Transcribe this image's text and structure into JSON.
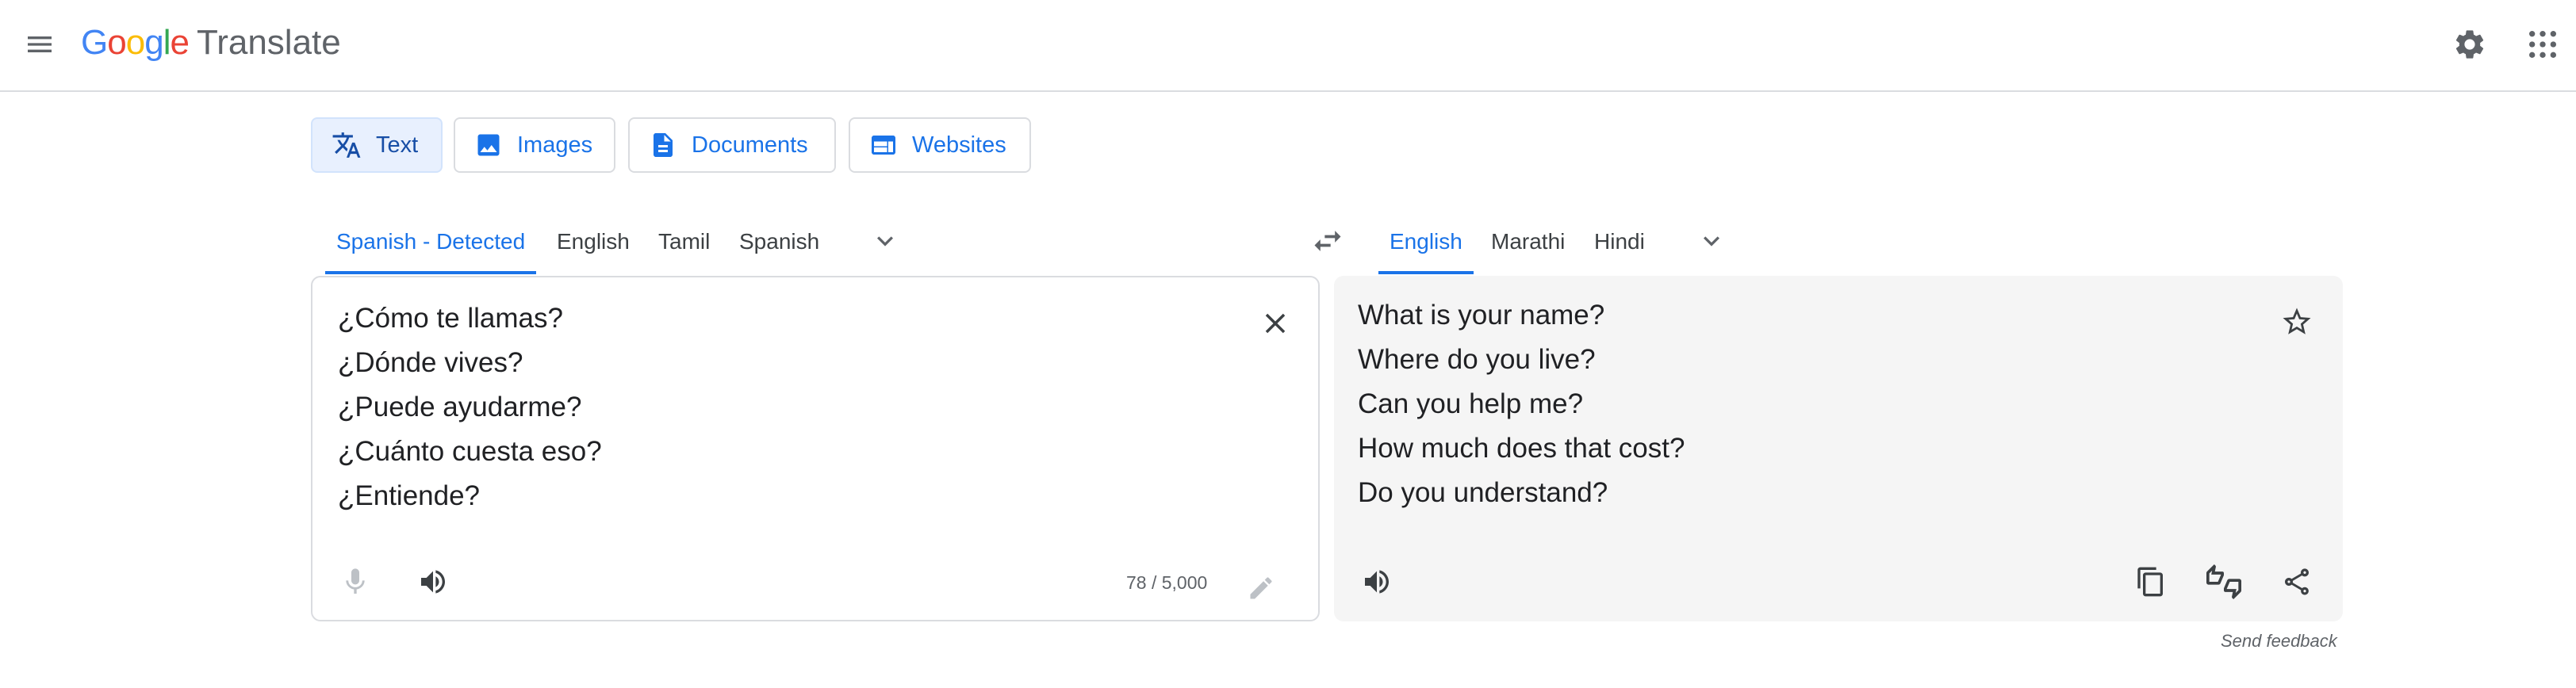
{
  "header": {
    "logo_letters": [
      "G",
      "o",
      "o",
      "g",
      "l",
      "e"
    ],
    "logo_colors": [
      "#4285f4",
      "#ea4335",
      "#fbbc05",
      "#4285f4",
      "#34a853",
      "#ea4335"
    ],
    "product": "Translate",
    "icons": {
      "menu": "menu-icon",
      "settings": "gear-icon",
      "apps": "apps-grid-icon"
    }
  },
  "modes": [
    {
      "label": "Text",
      "icon": "translate-icon",
      "active": true
    },
    {
      "label": "Images",
      "icon": "image-icon",
      "active": false
    },
    {
      "label": "Documents",
      "icon": "document-icon",
      "active": false
    },
    {
      "label": "Websites",
      "icon": "website-icon",
      "active": false
    }
  ],
  "source_langs": [
    "Spanish - Detected",
    "English",
    "Tamil",
    "Spanish"
  ],
  "target_langs": [
    "English",
    "Marathi",
    "Hindi"
  ],
  "source": {
    "lines": [
      "¿Cómo te llamas?",
      "¿Dónde vives?",
      "¿Puede ayudarme?",
      "¿Cuánto cuesta eso?",
      "¿Entiende?"
    ],
    "char_count": "78 / 5,000"
  },
  "target": {
    "lines": [
      "What is your name?",
      "Where do you live?",
      "Can you help me?",
      "How much does that cost?",
      "Do you understand?"
    ]
  },
  "feedback": "Send feedback",
  "colors": {
    "accent": "#1a73e8",
    "active_bg": "#e8f0fe",
    "panel_bg": "#f5f5f5",
    "border": "#dadce0"
  }
}
